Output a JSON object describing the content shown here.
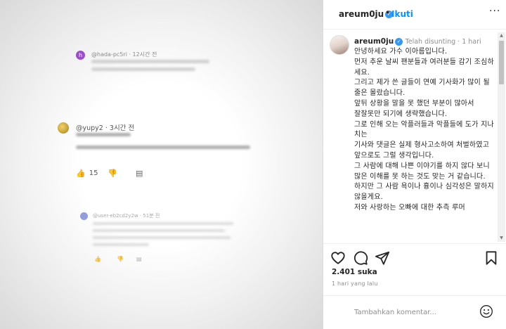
{
  "media": {
    "comments": [
      {
        "handle": "@hada-pc5ri · 12시간 전",
        "avatar_letter": "h",
        "avatar_color": "#9b4dca"
      },
      {
        "handle": "@yupy2 · 3시간 전",
        "avatar_color": "#c8a13a",
        "like_count": "15"
      },
      {
        "handle": "@user-eb2cd2y2w · 51분 전",
        "avatar_color": "#6f7fd1"
      }
    ]
  },
  "sidebar": {
    "username": "areum0ju",
    "dot": "•",
    "follow_label": "Ikuti",
    "more_label": "···",
    "caption": {
      "username": "areum0ju",
      "meta": "Telah disunting · 1 hari",
      "text": "안녕하세요 가수 이아름입니다.\n먼저 추운 날씨 팬분들과 여러분들 감기 조심하세요.\n그리고 제가 쓴 글들이 연예 기사화가 많이 될 줄은 몰랐습니다.\n앞뒤 상황을 말을 못 했던 부분이 많아서\n잘잘못만 되기에 생략했습니다.\n그로 인해 오는 악플러들과 악플들에 도가 지나치는\n기사와 댓글은 실제 형사고소하여 처벌하였고\n앞으로도 그럴 생각입니다.\n그 사람에 대해 나쁜 이야기를 하지 않다 보니\n많은 이해를 못 하는 것도 맞는 거 같습니다.\n하지만 그 사람 욕이나 흉이나 심각성은 말하지 않을게요.\n저와 사랑하는 오빠에 대한 추측 루머"
    },
    "likes": "2.401 suka",
    "time_ago": "1 hari yang lalu",
    "comment_placeholder": "Tambahkan komentar...",
    "icons": [
      "heart-icon",
      "comment-icon",
      "share-icon",
      "bookmark-icon",
      "emoji-icon"
    ],
    "accent_color": "#0095f6",
    "verified_color": "#3897f0"
  }
}
